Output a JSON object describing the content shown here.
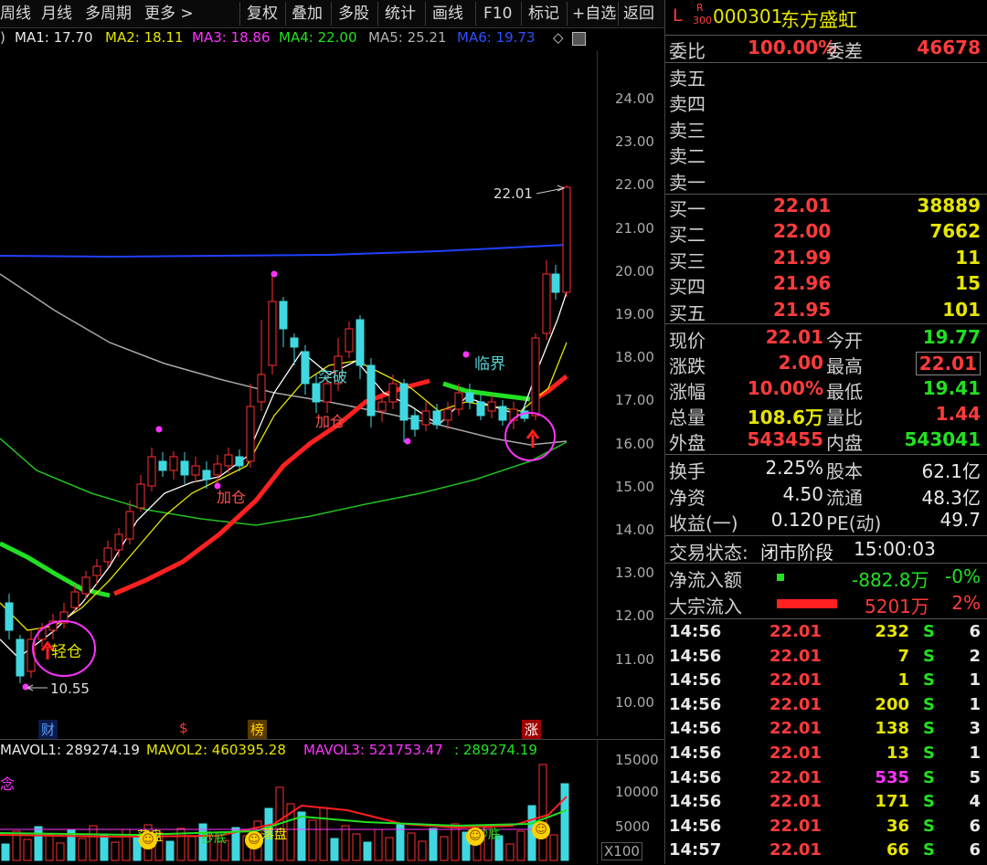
{
  "toolbar": {
    "left_items": [
      "周线",
      "月线",
      "多周期",
      "更多 >"
    ],
    "right_items": [
      "复权",
      "叠加",
      "多股",
      "统计",
      "画线",
      "F10",
      "标记",
      "+自选",
      "返回"
    ]
  },
  "ma_legend": {
    "paren": ")",
    "ma1": "MA1: 17.70",
    "ma2": "MA2: 18.11",
    "ma3": "MA3: 18.86",
    "ma4": "MA4: 22.00",
    "ma5": "MA5: 25.21",
    "ma6": "MA6: 19.73",
    "tools": "◇",
    "colors": {
      "ma1": "#e8e8e8",
      "ma2": "#e6e600",
      "ma3": "#ff33ff",
      "ma4": "#22e022",
      "ma5": "#a0a0a0",
      "ma6": "#3050ff"
    }
  },
  "price_axis": [
    "24.00",
    "23.00",
    "22.00",
    "21.00",
    "20.00",
    "19.00",
    "18.00",
    "17.00",
    "16.00",
    "15.00",
    "14.00",
    "13.00",
    "12.00",
    "11.00",
    "10.00"
  ],
  "chart_annotations": {
    "high_label": "22.01",
    "low_label": "10.55",
    "light_position": "轻仓",
    "add_position": "加仓",
    "add_position2": "加仓",
    "breakout": "突破",
    "critical": "临界",
    "event_markers": [
      "财",
      "$",
      "榜",
      "涨"
    ]
  },
  "volume": {
    "legend": {
      "mavol1": "MAVOL1: 289274.19",
      "mavol2": "MAVOL2: 460395.28",
      "mavol3": "MAVOL3: 521753.47",
      "extra": ": 289274.19"
    },
    "left_text": "念",
    "axis": [
      "15000",
      "10000",
      "5000"
    ],
    "unit": "X100",
    "tags": [
      "落盘",
      "抄底",
      "落盘",
      "抄底",
      "落盘",
      "落盘"
    ]
  },
  "quote": {
    "title_prefix": "L",
    "badge_top": "R",
    "badge_bottom": "300",
    "code": "000301",
    "name": "东方盛虹",
    "wei_bi_label": "委比",
    "wei_bi": "100.00%",
    "wei_cha_label": "委差",
    "wei_cha": "46678",
    "asks": [
      {
        "label": "卖五",
        "price": "",
        "vol": ""
      },
      {
        "label": "卖四",
        "price": "",
        "vol": ""
      },
      {
        "label": "卖三",
        "price": "",
        "vol": ""
      },
      {
        "label": "卖二",
        "price": "",
        "vol": ""
      },
      {
        "label": "卖一",
        "price": "",
        "vol": ""
      }
    ],
    "bids": [
      {
        "label": "买一",
        "price": "22.01",
        "vol": "38889"
      },
      {
        "label": "买二",
        "price": "22.00",
        "vol": "7662"
      },
      {
        "label": "买三",
        "price": "21.99",
        "vol": "11"
      },
      {
        "label": "买四",
        "price": "21.96",
        "vol": "15"
      },
      {
        "label": "买五",
        "price": "21.95",
        "vol": "101"
      }
    ],
    "stats": [
      {
        "l1": "现价",
        "v1": "22.01",
        "c1": "red",
        "l2": "今开",
        "v2": "19.77",
        "c2": "green"
      },
      {
        "l1": "涨跌",
        "v1": "2.00",
        "c1": "red",
        "l2": "最高",
        "v2": "22.01",
        "c2": "red"
      },
      {
        "l1": "涨幅",
        "v1": "10.00%",
        "c1": "red",
        "l2": "最低",
        "v2": "19.41",
        "c2": "green"
      },
      {
        "l1": "总量",
        "v1": "108.6万",
        "c1": "yellow",
        "l2": "量比",
        "v2": "1.44",
        "c2": "red"
      },
      {
        "l1": "外盘",
        "v1": "543455",
        "c1": "red",
        "l2": "内盘",
        "v2": "543041",
        "c2": "green"
      }
    ],
    "fundamentals": [
      {
        "l1": "换手",
        "v1": "2.25%",
        "l2": "股本",
        "v2": "62.1亿"
      },
      {
        "l1": "净资",
        "v1": "4.50",
        "l2": "流通",
        "v2": "48.3亿"
      },
      {
        "l1": "收益(一)",
        "v1": "0.120",
        "l2": "PE(动)",
        "v2": "49.7"
      }
    ],
    "trade_status_label": "交易状态:",
    "trade_status": "闭市阶段",
    "trade_time": "15:00:03",
    "net_inflow_label": "净流入额",
    "net_inflow": "-882.8万",
    "net_inflow_pct": "-0%",
    "block_inflow_label": "大宗流入",
    "block_inflow": "5201万",
    "block_inflow_pct": "2%"
  },
  "ticks": [
    {
      "time": "14:56",
      "price": "22.01",
      "vol": "232",
      "side": "S",
      "n": "6",
      "vc": "yellow"
    },
    {
      "time": "14:56",
      "price": "22.01",
      "vol": "7",
      "side": "S",
      "n": "2",
      "vc": "yellow"
    },
    {
      "time": "14:56",
      "price": "22.01",
      "vol": "1",
      "side": "S",
      "n": "1",
      "vc": "yellow"
    },
    {
      "time": "14:56",
      "price": "22.01",
      "vol": "200",
      "side": "S",
      "n": "1",
      "vc": "yellow"
    },
    {
      "time": "14:56",
      "price": "22.01",
      "vol": "138",
      "side": "S",
      "n": "3",
      "vc": "yellow"
    },
    {
      "time": "14:56",
      "price": "22.01",
      "vol": "13",
      "side": "S",
      "n": "1",
      "vc": "yellow"
    },
    {
      "time": "14:56",
      "price": "22.01",
      "vol": "535",
      "side": "S",
      "n": "5",
      "vc": "magenta"
    },
    {
      "time": "14:56",
      "price": "22.01",
      "vol": "171",
      "side": "S",
      "n": "4",
      "vc": "yellow"
    },
    {
      "time": "14:56",
      "price": "22.01",
      "vol": "36",
      "side": "S",
      "n": "6",
      "vc": "yellow"
    },
    {
      "time": "14:57",
      "price": "22.01",
      "vol": "66",
      "side": "S",
      "n": "6",
      "vc": "yellow"
    }
  ]
}
